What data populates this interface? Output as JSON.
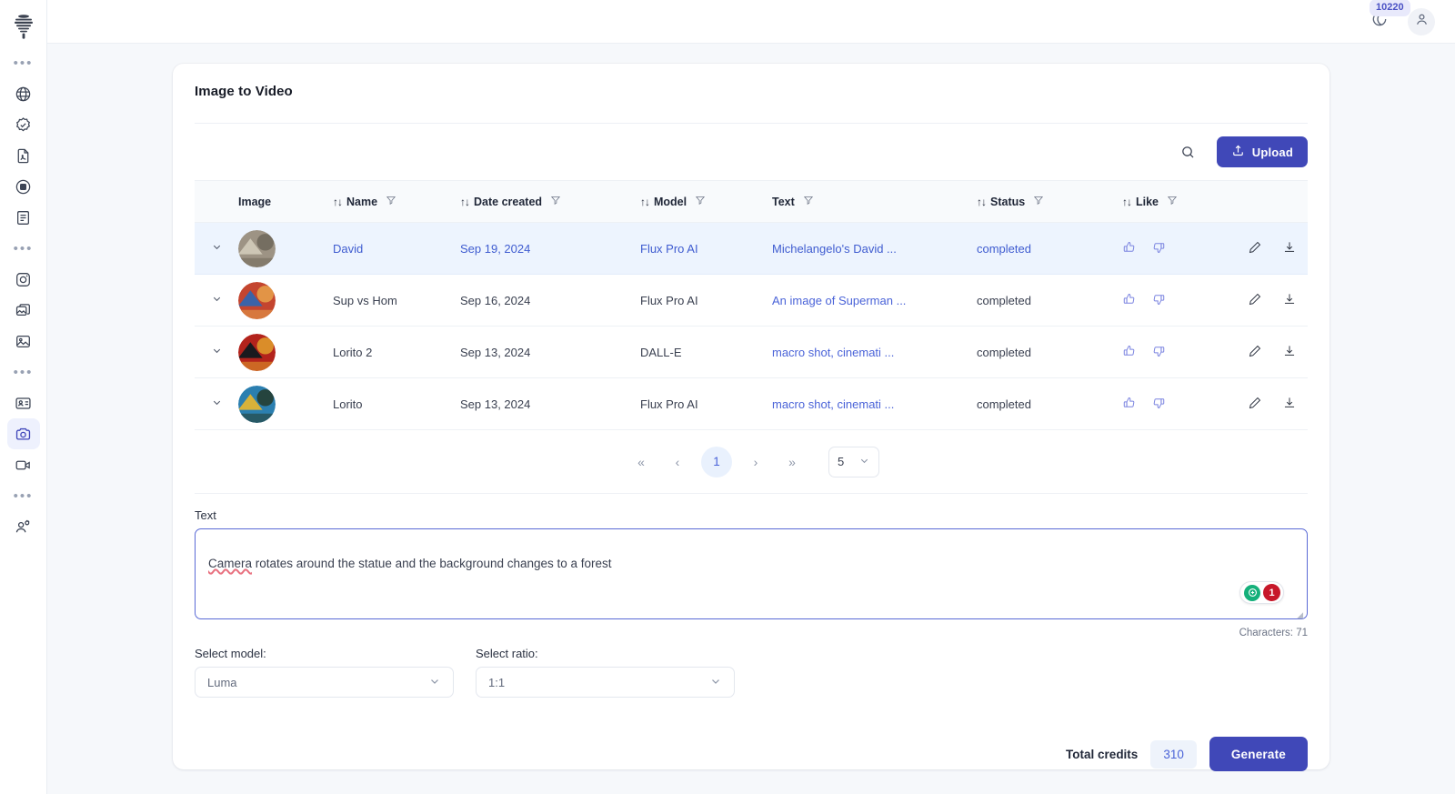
{
  "sidebar": {
    "logo_name": "app-logo",
    "items": [
      {
        "icon": "dots-icon",
        "label": "more"
      },
      {
        "icon": "globe-icon",
        "label": "globe"
      },
      {
        "icon": "check-badge-icon",
        "label": "verified"
      },
      {
        "icon": "pdf-file-icon",
        "label": "pdf"
      },
      {
        "icon": "record-icon",
        "label": "record"
      },
      {
        "icon": "document-icon",
        "label": "document"
      },
      {
        "icon": "dots-icon",
        "label": "more"
      },
      {
        "icon": "camera-lens-icon",
        "label": "camera lens"
      },
      {
        "icon": "images-stack-icon",
        "label": "images"
      },
      {
        "icon": "image-icon",
        "label": "image"
      },
      {
        "icon": "dots-icon",
        "label": "more"
      },
      {
        "icon": "id-card-icon",
        "label": "id card"
      },
      {
        "icon": "photo-camera-icon",
        "label": "image to video"
      },
      {
        "icon": "video-camera-icon",
        "label": "video"
      },
      {
        "icon": "dots-icon",
        "label": "more"
      },
      {
        "icon": "user-plus-icon",
        "label": "invite"
      }
    ],
    "active_index": 12
  },
  "topbar": {
    "credits_badge": "10220",
    "credits_icon": "coin-icon",
    "avatar_icon": "user-icon"
  },
  "card": {
    "title": "Image to Video"
  },
  "toolbar": {
    "search_icon": "search-icon",
    "upload_label": "Upload",
    "upload_icon": "upload-icon"
  },
  "table": {
    "columns": [
      {
        "key": "image",
        "label": "Image",
        "sortable": false,
        "filter": false
      },
      {
        "key": "name",
        "label": "Name",
        "sortable": true,
        "filter": true
      },
      {
        "key": "date",
        "label": "Date created",
        "sortable": true,
        "filter": true
      },
      {
        "key": "model",
        "label": "Model",
        "sortable": true,
        "filter": true
      },
      {
        "key": "text",
        "label": "Text",
        "sortable": false,
        "filter": true
      },
      {
        "key": "status",
        "label": "Status",
        "sortable": true,
        "filter": true
      },
      {
        "key": "like",
        "label": "Like",
        "sortable": true,
        "filter": true
      }
    ],
    "rows": [
      {
        "name": "David",
        "date": "Sep 19, 2024",
        "model": "Flux Pro AI",
        "text": "Michelangelo's David ...",
        "status": "completed",
        "selected": true,
        "thumb": "statue-thumbnail"
      },
      {
        "name": "Sup vs Hom",
        "date": "Sep 16, 2024",
        "model": "Flux Pro AI",
        "text": "An image of Superman ...",
        "status": "completed",
        "selected": false,
        "thumb": "superheroes-thumbnail"
      },
      {
        "name": "Lorito 2",
        "date": "Sep 13, 2024",
        "model": "DALL-E",
        "text": "macro shot, cinemati ...",
        "status": "completed",
        "selected": false,
        "thumb": "parrot-red-thumbnail"
      },
      {
        "name": "Lorito",
        "date": "Sep 13, 2024",
        "model": "Flux Pro AI",
        "text": "macro shot, cinemati ...",
        "status": "completed",
        "selected": false,
        "thumb": "parrot-blue-thumbnail"
      }
    ]
  },
  "pagination": {
    "first_label": "«",
    "prev_label": "‹",
    "current_page": "1",
    "next_label": "›",
    "last_label": "»",
    "page_size": "5"
  },
  "form": {
    "text_label": "Text",
    "text_value": "Camera rotates around the statue and the background changes to a forest",
    "misspelled_word": "Camera",
    "text_rest": " rotates around the statue and the background changes to a forest",
    "char_count": "Characters: 71",
    "grammarly_count": "1",
    "model_label": "Select model:",
    "model_value": "Luma",
    "ratio_label": "Select ratio:",
    "ratio_value": "1:1"
  },
  "footer": {
    "total_credits_label": "Total credits",
    "total_credits_value": "310",
    "generate_label": "Generate"
  },
  "colors": {
    "accent": "#4048b8",
    "link": "#4a63d8",
    "row_selected_bg": "#edf4fe",
    "page_bg": "#f6f8fb",
    "badge_bg": "#e8e9fb",
    "danger": "#c7182a",
    "success": "#15b07b"
  }
}
